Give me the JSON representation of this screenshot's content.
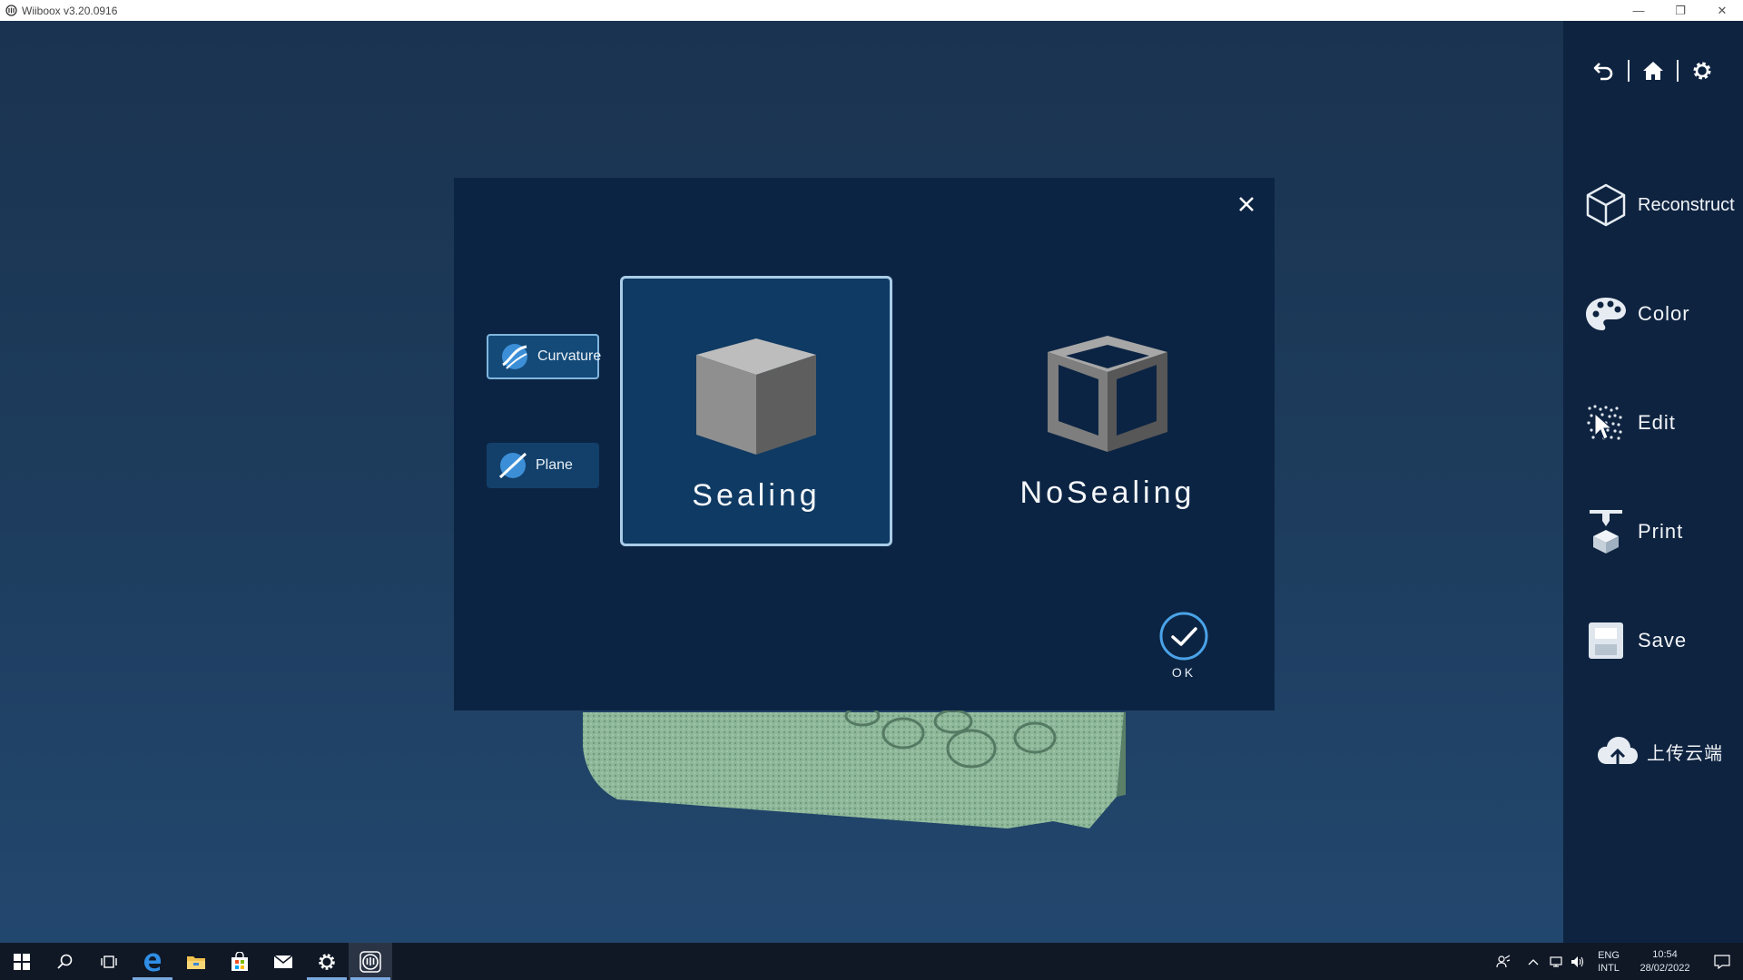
{
  "window": {
    "title": "Wiiboox v3.20.0916",
    "minimize": "—",
    "restore": "❐",
    "close": "✕"
  },
  "top_toolbar": {
    "icons": [
      "undo-icon",
      "home-icon",
      "gear-icon"
    ]
  },
  "side_menu": {
    "items": [
      {
        "label": "Reconstruct",
        "icon": "cube-outline-icon"
      },
      {
        "label": "Color",
        "icon": "palette-icon"
      },
      {
        "label": "Edit",
        "icon": "dots-cursor-icon"
      },
      {
        "label": "Print",
        "icon": "printer-nozzle-icon"
      },
      {
        "label": "Save",
        "icon": "save-disk-icon"
      },
      {
        "label": "上传云端",
        "icon": "cloud-upload-icon"
      }
    ]
  },
  "dialog": {
    "side_buttons": [
      {
        "label": "Curvature",
        "icon": "curvature-icon",
        "active": true
      },
      {
        "label": "Plane",
        "icon": "plane-icon",
        "active": false
      }
    ],
    "options": [
      {
        "label": "Sealing",
        "icon": "solid-cube-icon",
        "selected": true
      },
      {
        "label": "NoSealing",
        "icon": "wireframe-cube-icon",
        "selected": false
      }
    ],
    "ok_label": "OK"
  },
  "taskbar": {
    "apps": [
      "windows-start-icon",
      "search-icon",
      "task-view-icon",
      "edge-icon",
      "file-explorer-icon",
      "store-icon",
      "mail-icon",
      "settings-icon",
      "wiiboox-icon"
    ],
    "tray": {
      "lang_top": "ENG",
      "lang_bottom": "INTL",
      "time": "10:54",
      "date": "28/02/2022"
    }
  },
  "colors": {
    "panel": "#0e2340",
    "dialog": "#0c2443",
    "accent": "#a9cce8",
    "side_button": "#12406b",
    "icon_blue": "#3c8fd6"
  }
}
